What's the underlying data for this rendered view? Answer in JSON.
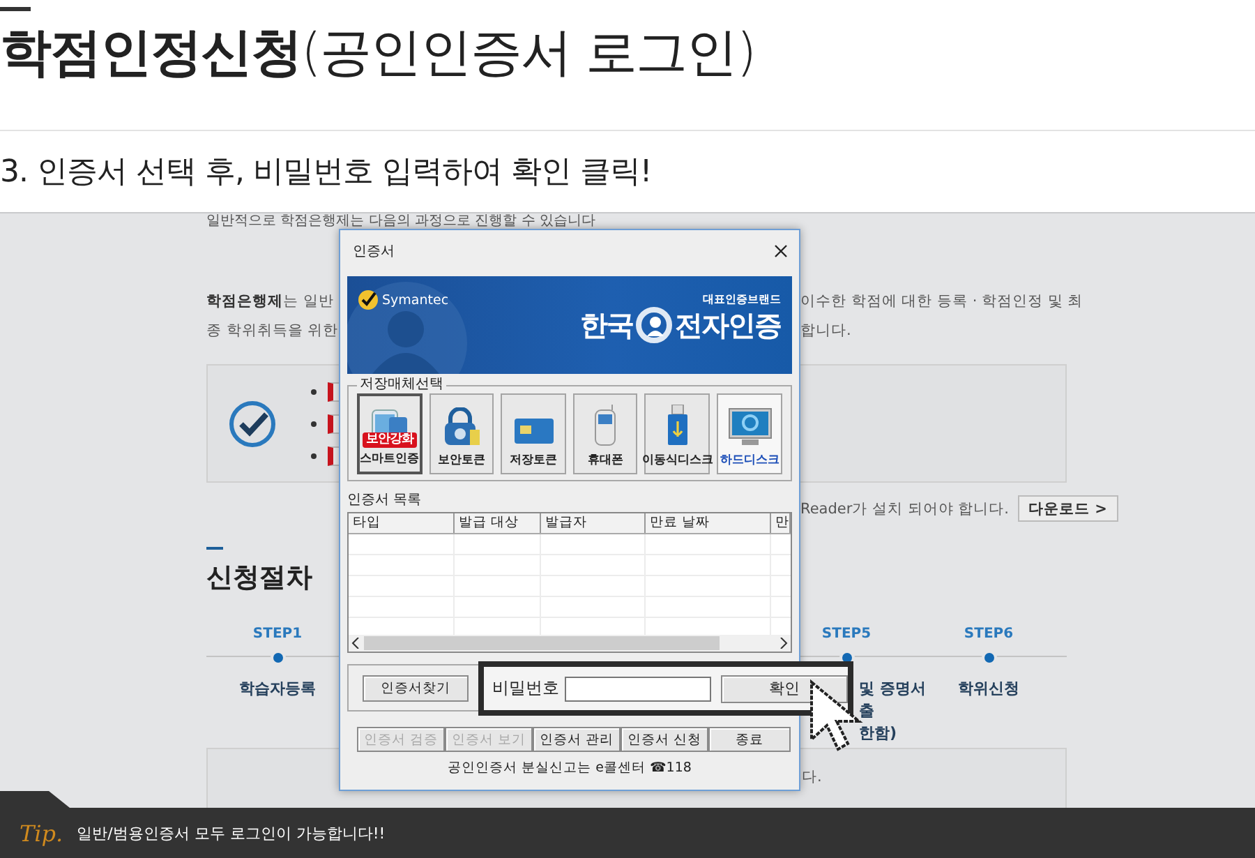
{
  "page_header": {
    "title": "**학점인정신청**(공인인증서 로그인)",
    "instruction": "3. 인증서 선택 후, 비밀번호 입력하여 확인 클릭!"
  },
  "background_page": {
    "intro": "일반적으로 학점은행제는 다음의 과정으로 진행할 수 있습니다",
    "paragraph_lines": [
      {
        "left": "**학점은행제**는 일반",
        "right": "이수한 학점에 대한 등록 · 학점인정 및 최"
      },
      {
        "left": "종 학위취득을 위한",
        "right": "합니다."
      }
    ],
    "reader_notice": "Reader가 설치 되어야 합니다.",
    "download_button": "다운로드 >",
    "procedure_heading": "신청절차",
    "steps": [
      {
        "step": "STEP1",
        "kind": "full",
        "label_lines": [
          "학습자등록"
        ]
      },
      {
        "step": "STEP5",
        "kind": "cut",
        "label_lines": [
          "및 증명서",
          "출",
          "한함)"
        ]
      },
      {
        "step": "STEP6",
        "kind": "full",
        "label_lines": [
          "학위신청"
        ]
      }
    ],
    "bottom_notice": "다."
  },
  "dialog": {
    "title": "인증서",
    "banner": {
      "vendor": "Symantec",
      "tagline": "대표인증브랜드",
      "brand_left": "한국",
      "brand_right": "전자인증"
    },
    "storage_group": {
      "legend": "저장매체선택",
      "media": [
        {
          "label": "스마트인증",
          "kind": "smart",
          "badge": "보안강화",
          "focused": true,
          "selected": false
        },
        {
          "label": "보안토큰",
          "kind": "lock",
          "focused": false,
          "selected": false
        },
        {
          "label": "저장토큰",
          "kind": "card",
          "focused": false,
          "selected": false
        },
        {
          "label": "휴대폰",
          "kind": "phone",
          "focused": false,
          "selected": false
        },
        {
          "label": "이동식디스크",
          "kind": "usb",
          "focused": false,
          "selected": false
        },
        {
          "label": "하드디스크",
          "kind": "monitor",
          "focused": false,
          "selected": true
        }
      ]
    },
    "cert_list": {
      "label": "인증서 목록",
      "columns": [
        "타입",
        "발급 대상",
        "발급자",
        "만료 날짜",
        "만"
      ]
    },
    "find_button": "인증서찾기",
    "password": {
      "label": "비밀번호",
      "confirm_button": "확인"
    },
    "actions": [
      {
        "label": "인증서 검증",
        "disabled": true
      },
      {
        "label": "인증서 보기",
        "disabled": true
      },
      {
        "label": "인증서 관리",
        "disabled": false
      },
      {
        "label": "인증서 신청",
        "disabled": false
      },
      {
        "label": "종료",
        "disabled": false
      }
    ],
    "footer": "공인인증서 분실신고는 e콜센터 ☎118"
  },
  "tip": {
    "badge": "Tip.",
    "text": "일반/범용인증서 모두 로그인이 가능합니다!!"
  }
}
